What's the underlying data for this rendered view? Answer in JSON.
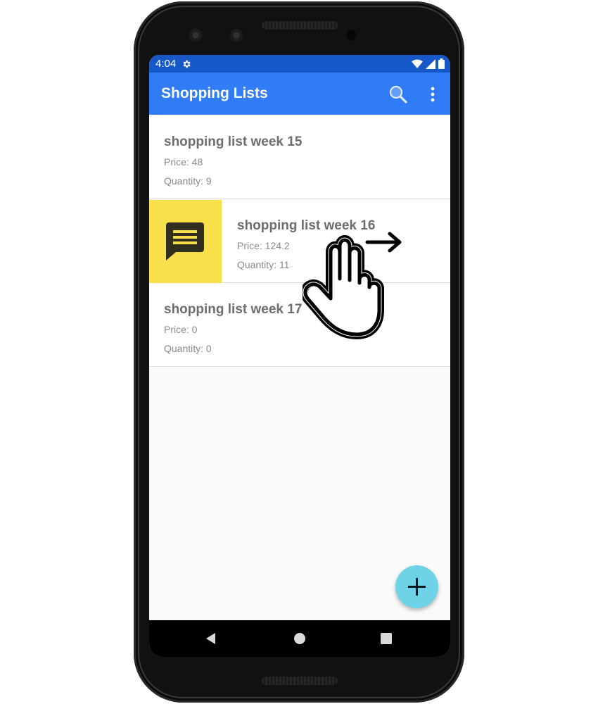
{
  "status_bar": {
    "time": "4:04",
    "icons": [
      "gear-icon",
      "wifi-icon",
      "signal-icon",
      "battery-icon"
    ]
  },
  "app_bar": {
    "title": "Shopping Lists",
    "actions": [
      "search-icon",
      "overflow-menu-icon"
    ]
  },
  "shopping_lists": [
    {
      "title": "shopping list week 15",
      "price": "Price: 48",
      "quantity": "Quantity: 9"
    },
    {
      "title": "shopping list week 16",
      "price": "Price: 124.2",
      "quantity": "Quantity: 11",
      "swipe_action_icon": "message-icon"
    },
    {
      "title": "shopping list week 17",
      "price": "Price: 0",
      "quantity": "Quantity: 0"
    }
  ],
  "fab": {
    "icon": "plus-icon"
  },
  "nav_bar": {
    "buttons": [
      "back-icon",
      "home-icon",
      "recents-icon"
    ]
  },
  "gesture_hint": {
    "icon": "swipe-right-hand-icon"
  },
  "colors": {
    "status_bar": "#1758c8",
    "app_bar": "#2f7cf6",
    "swipe_action": "#f7e04a",
    "fab": "#6ed3e6",
    "item_title": "#6d6d6d",
    "item_detail": "#8a8a8a"
  }
}
